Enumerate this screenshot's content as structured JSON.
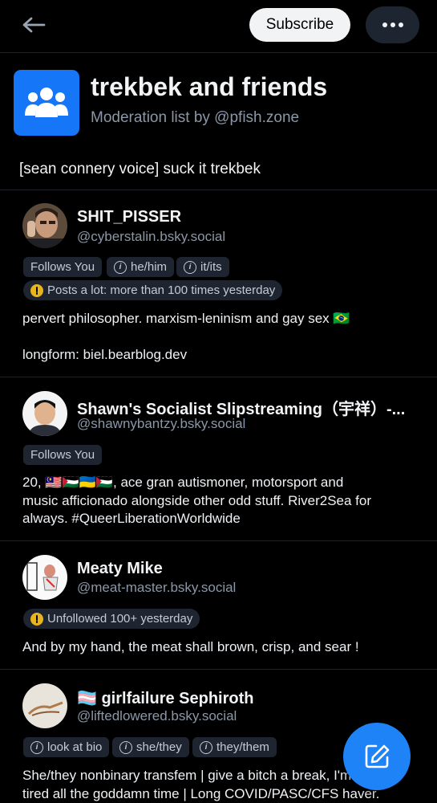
{
  "header": {
    "subscribe_label": "Subscribe"
  },
  "list": {
    "title": "trekbek and friends",
    "subtitle": "Moderation list by @pfish.zone",
    "description": "[sean connery voice] suck it trekbek"
  },
  "members": [
    {
      "name": "SHIT_PISSER",
      "handle": "@cyberstalin.bsky.social",
      "badges": [
        "Follows You",
        "he/him",
        "it/its"
      ],
      "alert": "Posts a lot: more than 100 times yesterday",
      "bio_line1": "pervert philosopher. marxism-leninism and gay sex 🇧🇷",
      "bio_line2": "longform: biel.bearblog.dev"
    },
    {
      "name": "Shawn's Socialist Slipstreaming（宇祥）-...",
      "handle": "@shawnybantzy.bsky.social",
      "badges": [
        "Follows You"
      ],
      "bio_line1": "20, 🇲🇾🇵🇸🇺🇦🇵🇸, ace gran autismoner, motorsport and",
      "bio_line2": "music afficionado alongside other odd stuff. River2Sea for",
      "bio_line3": "always. #QueerLiberationWorldwide"
    },
    {
      "name": "Meaty Mike",
      "handle": "@meat-master.bsky.social",
      "alert": "Unfollowed 100+ yesterday",
      "bio_line1": "And by my hand, the meat shall brown, crisp, and sear !"
    },
    {
      "name": "girlfailure Sephiroth",
      "flag": "🏳️‍⚧️",
      "handle": "@liftedlowered.bsky.social",
      "badges": [
        "look at bio",
        "she/they",
        "they/them"
      ],
      "bio_line1": "She/they nonbinary transfem | give a bitch a break, I'm",
      "bio_line2": "tired all the goddamn time | Long COVID/PASC/CFS haver."
    }
  ],
  "colors": {
    "accent": "#1d83f7",
    "list_avatar": "#1576f7",
    "muted": "#8b97a7",
    "pill_bg": "#1e2530",
    "alert": "#e8b61c"
  },
  "icons": [
    "back-arrow-icon",
    "more-dots-icon",
    "group-icon",
    "info-icon",
    "alert-icon",
    "compose-icon"
  ]
}
